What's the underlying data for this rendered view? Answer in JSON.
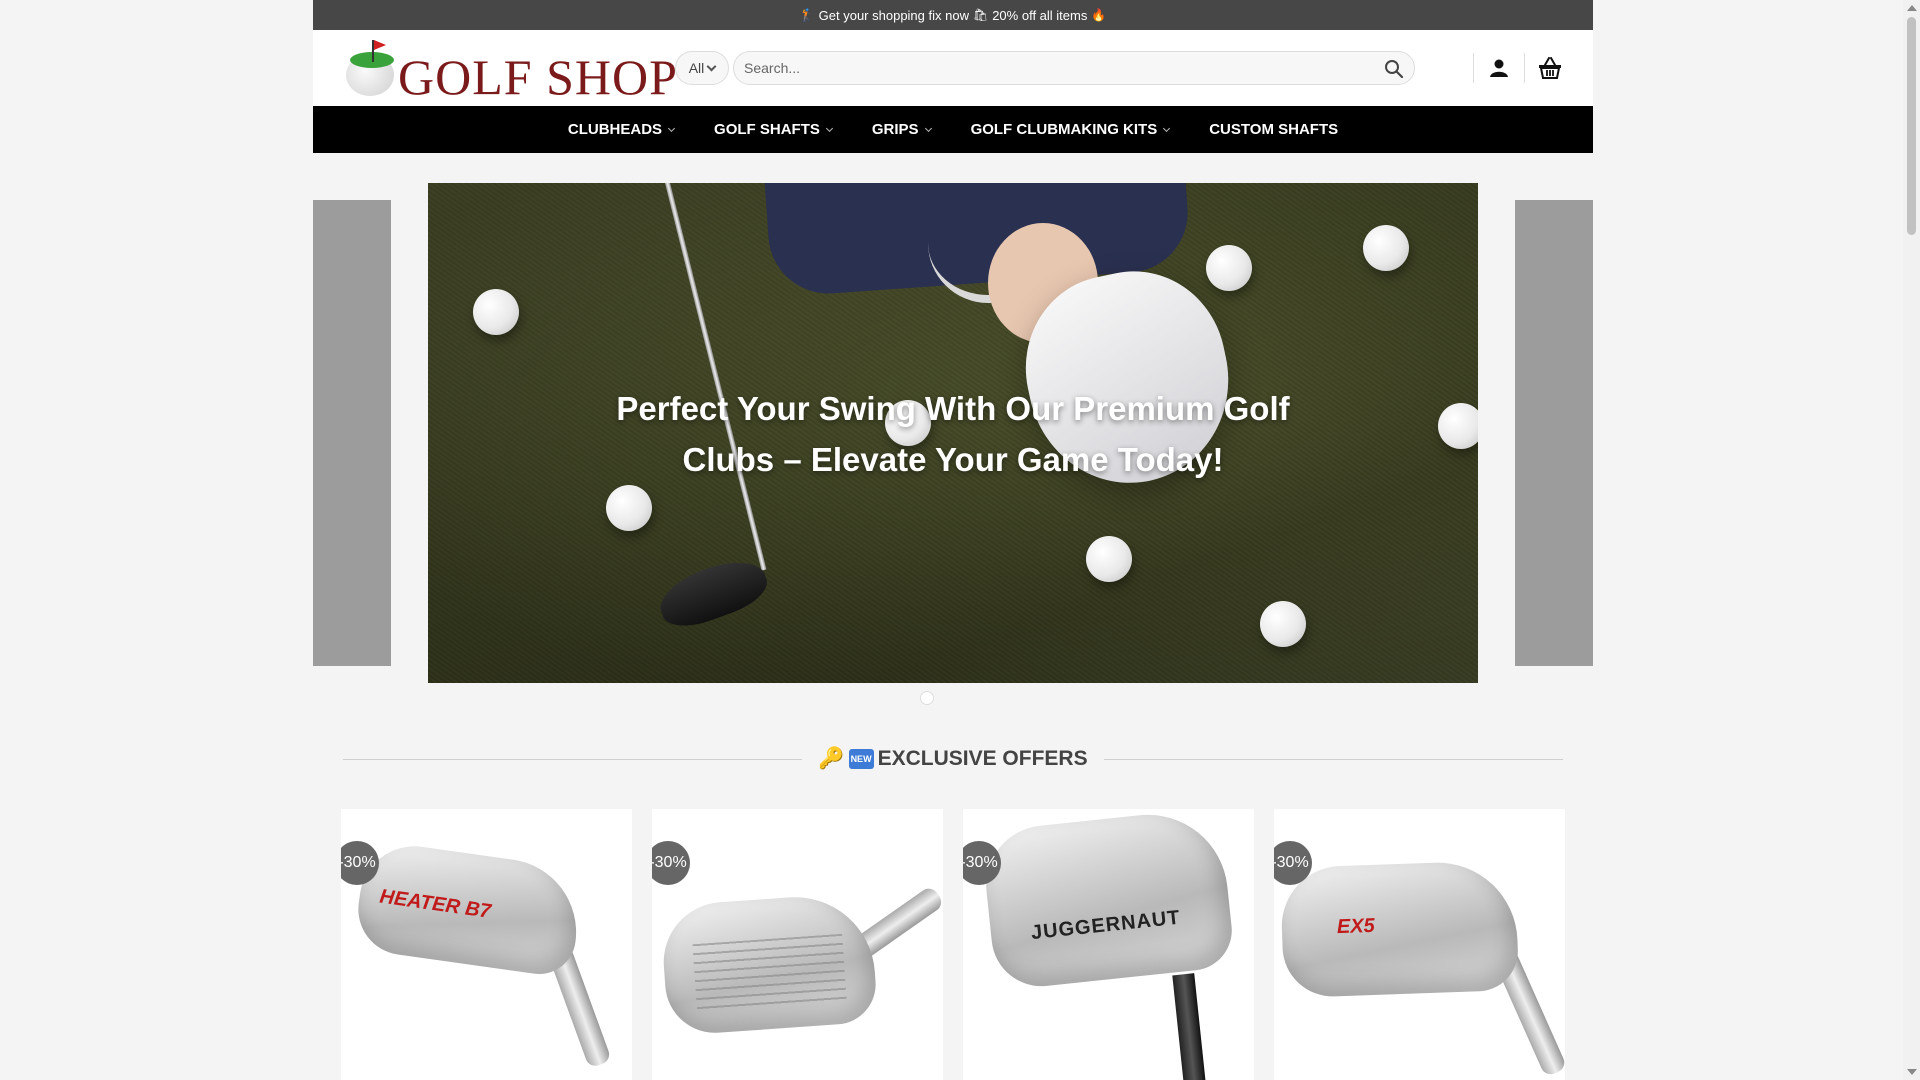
{
  "topbar": {
    "emoji_left": "🏌",
    "text": "Get your shopping fix now",
    "emoji_mid": "🛍",
    "text2": "20% off all items",
    "emoji_right": "🔥"
  },
  "header": {
    "logo_text": "GOLF SHOP",
    "search": {
      "category": "All",
      "placeholder": "Search..."
    },
    "icons": [
      "user-icon",
      "basket-icon"
    ]
  },
  "nav": {
    "items": [
      {
        "label": "CLUBHEADS",
        "has_dropdown": true
      },
      {
        "label": "GOLF SHAFTS",
        "has_dropdown": true
      },
      {
        "label": "GRIPS",
        "has_dropdown": true
      },
      {
        "label": "GOLF CLUBMAKING KITS",
        "has_dropdown": true
      },
      {
        "label": "CUSTOM SHAFTS",
        "has_dropdown": false
      }
    ]
  },
  "hero": {
    "headline_line1": "Perfect Your Swing With Our Premium Golf",
    "headline_line2": "Clubs – Elevate Your Game Today!",
    "dots": 1
  },
  "section": {
    "icon1": "🔑",
    "icon2": "NEW",
    "title": "EXCLUSIVE OFFERS"
  },
  "products": [
    {
      "badge": "-30%",
      "label": "HEATER B7"
    },
    {
      "badge": "-30%",
      "label": ""
    },
    {
      "badge": "-30%",
      "label": "JUGGERNAUT"
    },
    {
      "badge": "-30%",
      "label": "EX5"
    }
  ],
  "colors": {
    "topbar_bg": "#474747",
    "nav_bg": "#000000",
    "page_bg": "#f4f4f4",
    "logo_text": "#7b1a1a",
    "badge_bg": "#666666"
  }
}
